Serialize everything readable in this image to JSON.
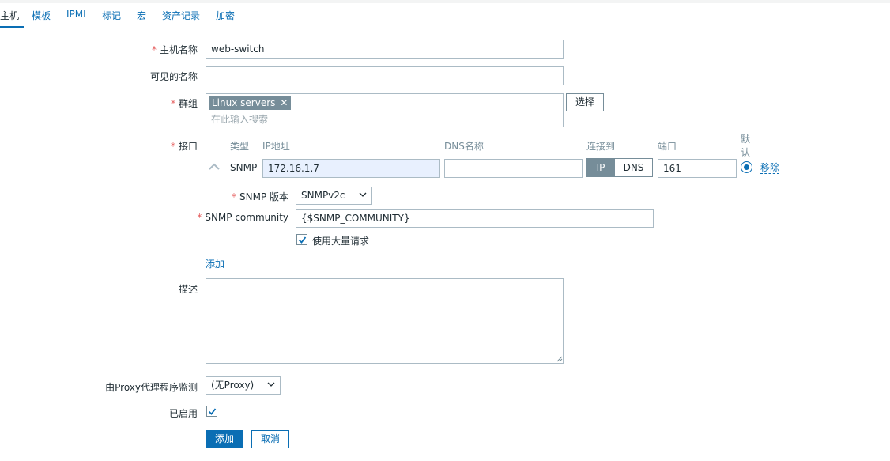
{
  "tabs": [
    {
      "label": "主机"
    },
    {
      "label": "模板"
    },
    {
      "label": "IPMI"
    },
    {
      "label": "标记"
    },
    {
      "label": "宏"
    },
    {
      "label": "资产记录"
    },
    {
      "label": "加密"
    }
  ],
  "form": {
    "host_name": {
      "label": "主机名称",
      "value": "web-switch"
    },
    "visible_name": {
      "label": "可见的名称",
      "value": ""
    },
    "groups": {
      "label": "群组",
      "chips": [
        {
          "label": "Linux servers"
        }
      ],
      "placeholder": "在此输入搜索",
      "select_button": "选择"
    },
    "interfaces": {
      "label": "接口",
      "headers": {
        "type": "类型",
        "ip": "IP地址",
        "dns": "DNS名称",
        "connect_to": "连接到",
        "port": "端口",
        "default_line1": "默",
        "default_line2": "认"
      },
      "row": {
        "type": "SNMP",
        "ip": "172.16.1.7",
        "dns": "",
        "connect_ip": "IP",
        "connect_dns": "DNS",
        "port": "161",
        "remove": "移除"
      },
      "snmp_version": {
        "label": "SNMP 版本",
        "value": "SNMPv2c"
      },
      "snmp_community": {
        "label": "SNMP community",
        "value": "{$SNMP_COMMUNITY}"
      },
      "bulk_requests": {
        "label": "使用大量请求",
        "checked": true
      },
      "add_link": "添加"
    },
    "description": {
      "label": "描述",
      "value": ""
    },
    "proxy": {
      "label": "由Proxy代理程序监测",
      "value": "(无Proxy)"
    },
    "enabled": {
      "label": "已启用",
      "checked": true
    },
    "buttons": {
      "add": "添加",
      "cancel": "取消"
    }
  },
  "colors": {
    "link": "#0a6eb4",
    "required": "#e45959",
    "chip_bg": "#768d99",
    "autofill_bg": "#e8f0fe"
  }
}
